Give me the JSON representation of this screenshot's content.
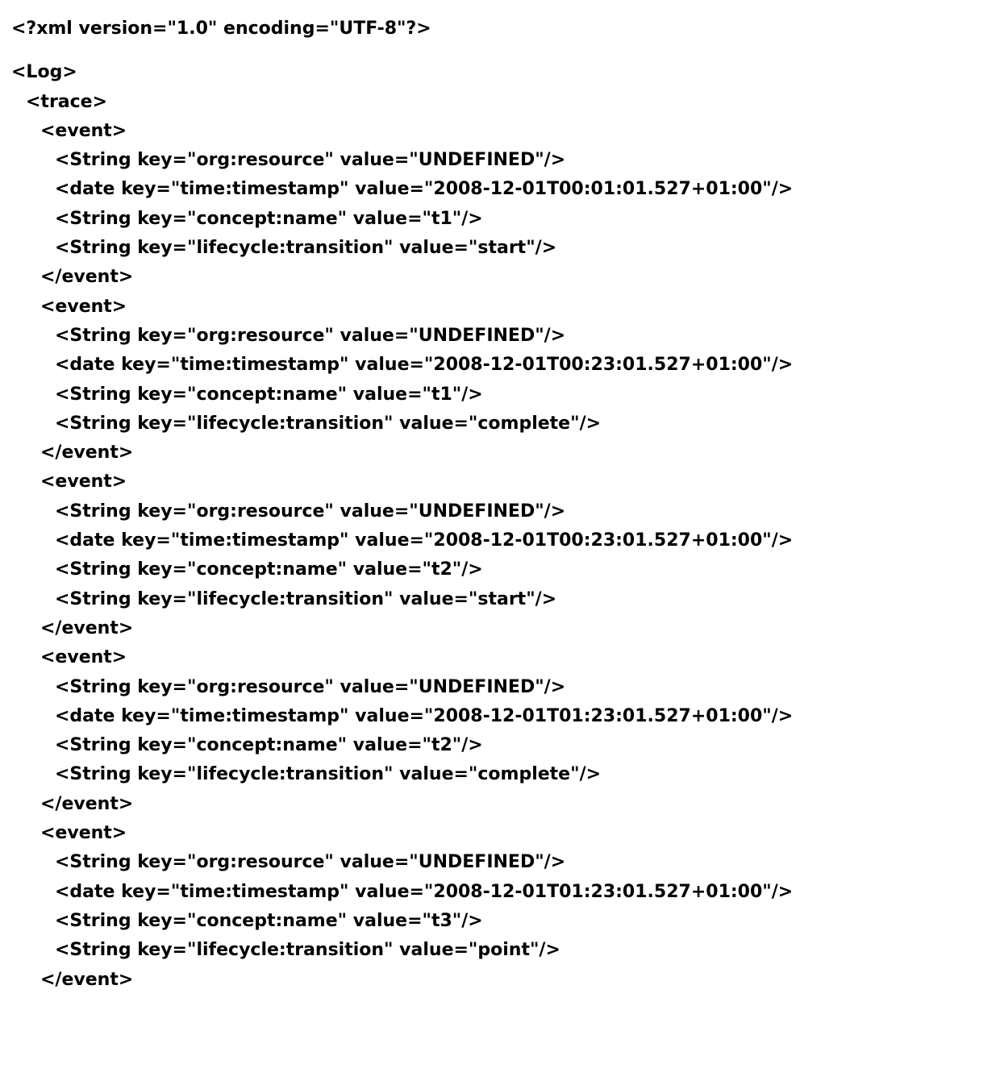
{
  "xml": {
    "decl": "<?xml version=\"1.0\" encoding=\"UTF-8\"?>",
    "root_open": "<Log>",
    "trace_open": "<trace>",
    "event_open": "<event>",
    "event_close": "</event>",
    "events": [
      {
        "l1": "<String key=\"org:resource\" value=\"UNDEFINED\"/>",
        "l2": "<date key=\"time:timestamp\" value=\"2008-12-01T00:01:01.527+01:00\"/>",
        "l3": "<String key=\"concept:name\" value=\"t1\"/>",
        "l4": "<String key=\"lifecycle:transition\" value=\"start\"/>"
      },
      {
        "l1": "<String key=\"org:resource\" value=\"UNDEFINED\"/>",
        "l2": "<date key=\"time:timestamp\" value=\"2008-12-01T00:23:01.527+01:00\"/>",
        "l3": "<String key=\"concept:name\" value=\"t1\"/>",
        "l4": "<String key=\"lifecycle:transition\" value=\"complete\"/>"
      },
      {
        "l1": "<String key=\"org:resource\" value=\"UNDEFINED\"/>",
        "l2": "<date key=\"time:timestamp\" value=\"2008-12-01T00:23:01.527+01:00\"/>",
        "l3": "<String key=\"concept:name\" value=\"t2\"/>",
        "l4": "<String key=\"lifecycle:transition\" value=\"start\"/>"
      },
      {
        "l1": "<String key=\"org:resource\" value=\"UNDEFINED\"/>",
        "l2": "<date key=\"time:timestamp\" value=\"2008-12-01T01:23:01.527+01:00\"/>",
        "l3": "<String key=\"concept:name\" value=\"t2\"/>",
        "l4": "<String key=\"lifecycle:transition\" value=\"complete\"/>"
      },
      {
        "l1": "<String key=\"org:resource\" value=\"UNDEFINED\"/>",
        "l2": "<date key=\"time:timestamp\" value=\"2008-12-01T01:23:01.527+01:00\"/>",
        "l3": "<String key=\"concept:name\" value=\"t3\"/>",
        "l4": "<String key=\"lifecycle:transition\" value=\"point\"/>"
      }
    ]
  }
}
